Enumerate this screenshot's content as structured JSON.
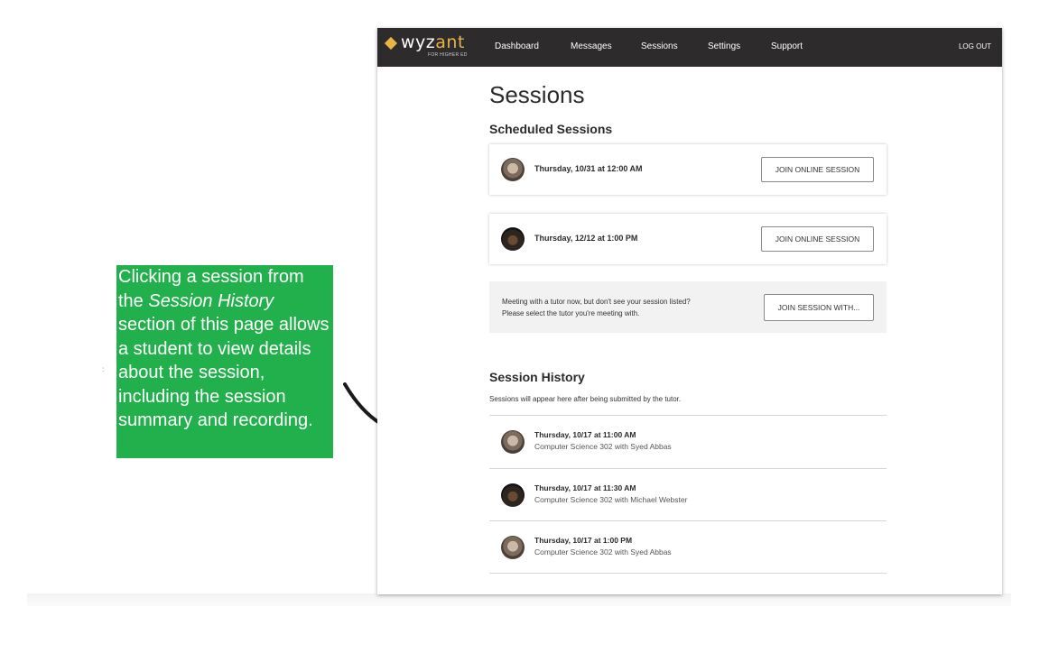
{
  "annotation": {
    "text_before": "Clicking a session from the ",
    "text_em": "Session History",
    "text_after": " section of this page allows a student to view details about the session, including the session summary and recording.",
    "color": "#21b04b"
  },
  "app": {
    "logo_text_part1": "wyz",
    "logo_text_part2": "ant",
    "logo_sub": "FOR HIGHER ED",
    "brand_color": "#e8b34a",
    "nav": [
      "Dashboard",
      "Messages",
      "Sessions",
      "Settings",
      "Support"
    ],
    "logout": "LOG OUT"
  },
  "page": {
    "title": "Sessions",
    "scheduled_title": "Scheduled Sessions",
    "scheduled": [
      {
        "date": "Thursday, 10/31 at 12:00 AM",
        "button": "JOIN ONLINE SESSION"
      },
      {
        "date": "Thursday, 12/12 at 1:00 PM",
        "button": "JOIN ONLINE SESSION"
      }
    ],
    "notice": {
      "line1": "Meeting with a tutor now, but don't see your session listed?",
      "line2": "Please select the tutor you're meeting with.",
      "button": "JOIN SESSION WITH..."
    },
    "history_title": "Session History",
    "history_note": "Sessions will appear here after being submitted by the tutor.",
    "history": [
      {
        "date": "Thursday, 10/17 at 11:00 AM",
        "subtitle": "Computer Science 302 with Syed Abbas"
      },
      {
        "date": "Thursday, 10/17 at 11:30 AM",
        "subtitle": "Computer Science 302 with Michael Webster"
      },
      {
        "date": "Thursday, 10/17 at 1:00 PM",
        "subtitle": "Computer Science 302 with Syed Abbas"
      }
    ]
  }
}
